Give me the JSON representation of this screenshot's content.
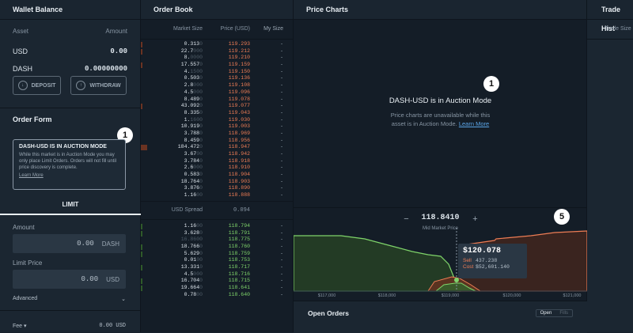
{
  "wallet": {
    "title": "Wallet Balance",
    "col_asset": "Asset",
    "col_amount": "Amount",
    "balances": [
      {
        "asset": "USD",
        "amount": "0.00"
      },
      {
        "asset": "DASH",
        "amount": "0.00000000"
      }
    ],
    "deposit_label": "DEPOSIT",
    "withdraw_label": "WITHDRAW"
  },
  "order_form": {
    "title": "Order Form",
    "notice_title": "DASH-USD IS IN AUCTION MODE",
    "notice_body": "While this market is in Auction Mode you may only place Limit Orders. Orders will not fill until price discovery is complete.",
    "notice_link": "Learn More",
    "tab_limit": "LIMIT",
    "amount_label": "Amount",
    "amount_value": "0.00",
    "amount_unit": "DASH",
    "limit_price_label": "Limit Price",
    "limit_price_value": "0.00",
    "limit_price_unit": "USD",
    "advanced_label": "Advanced",
    "fee_label": "Fee",
    "fee_value": "0.00 USD"
  },
  "badges": {
    "one": "1",
    "five": "5"
  },
  "order_book": {
    "title": "Order Book",
    "col_size": "Market Size",
    "col_price": "Price (USD)",
    "col_mine": "My Size",
    "asks": [
      {
        "size": "0.313",
        "dim": "0",
        "price": "119.293",
        "mine": "-"
      },
      {
        "size": "22.7",
        "dim": "000",
        "price": "119.212",
        "mine": "-"
      },
      {
        "size": "8.",
        "dim": "0000",
        "price": "119.210",
        "mine": "-"
      },
      {
        "size": "17.557",
        "dim": "0",
        "price": "119.159",
        "mine": "-"
      },
      {
        "size": "4.",
        "dim": "1500",
        "price": "119.150",
        "mine": "-"
      },
      {
        "size": "0.503",
        "dim": "0",
        "price": "119.136",
        "mine": "-"
      },
      {
        "size": "2.8",
        "dim": "000",
        "price": "119.108",
        "mine": "-"
      },
      {
        "size": "4.5",
        "dim": "000",
        "price": "119.096",
        "mine": "-"
      },
      {
        "size": "8.489",
        "dim": "0",
        "price": "119.078",
        "mine": "-"
      },
      {
        "size": "43.092",
        "dim": "0",
        "price": "119.077",
        "mine": "-"
      },
      {
        "size": "8.335",
        "dim": "0",
        "price": "119.043",
        "mine": "-"
      },
      {
        "size": "1.",
        "dim": "1600",
        "price": "119.030",
        "mine": "-"
      },
      {
        "size": "10.919",
        "dim": "0",
        "price": "119.003",
        "mine": "-"
      },
      {
        "size": "3.788",
        "dim": "0",
        "price": "118.969",
        "mine": "-"
      },
      {
        "size": "8.459",
        "dim": "0",
        "price": "118.956",
        "mine": "-"
      },
      {
        "size": "184.472",
        "dim": "0",
        "price": "118.947",
        "mine": "-"
      },
      {
        "size": "3.67",
        "dim": "00",
        "price": "118.942",
        "mine": "-"
      },
      {
        "size": "3.784",
        "dim": "0",
        "price": "118.918",
        "mine": "-"
      },
      {
        "size": "2.6",
        "dim": "000",
        "price": "118.910",
        "mine": "-"
      },
      {
        "size": "0.583",
        "dim": "0",
        "price": "118.904",
        "mine": "-"
      },
      {
        "size": "18.764",
        "dim": "0",
        "price": "118.903",
        "mine": "-"
      },
      {
        "size": "3.876",
        "dim": "0",
        "price": "118.890",
        "mine": "-"
      },
      {
        "size": "1.16",
        "dim": "00",
        "price": "118.888",
        "mine": "-"
      }
    ],
    "spread_label": "USD Spread",
    "spread_value": "0.094",
    "bids": [
      {
        "size": "1.16",
        "dim": "00",
        "price": "118.794",
        "mine": "-"
      },
      {
        "size": "3.628",
        "dim": "0",
        "price": "118.791",
        "mine": "-"
      },
      {
        "size": "",
        "dim": "16.8600",
        "price": "118.775",
        "mine": "-"
      },
      {
        "size": "18.766",
        "dim": "0",
        "price": "118.760",
        "mine": "-"
      },
      {
        "size": "5.629",
        "dim": "0",
        "price": "118.759",
        "mine": "-"
      },
      {
        "size": "0.01",
        "dim": "00",
        "price": "118.753",
        "mine": "-"
      },
      {
        "size": "13.331",
        "dim": "0",
        "price": "118.717",
        "mine": "-"
      },
      {
        "size": "4.5",
        "dim": "000",
        "price": "118.716",
        "mine": "-"
      },
      {
        "size": "16.704",
        "dim": "0",
        "price": "118.715",
        "mine": "-"
      },
      {
        "size": "19.664",
        "dim": "0",
        "price": "118.641",
        "mine": "-"
      },
      {
        "size": "0.78",
        "dim": "00",
        "price": "118.640",
        "mine": "-"
      }
    ]
  },
  "charts": {
    "title": "Price Charts",
    "auction_title": "DASH-USD is in Auction Mode",
    "auction_body_1": "Price charts are unavailable while this",
    "auction_body_2": "asset is in Auction Mode.",
    "auction_link": "Learn More",
    "minus": "−",
    "plus": "+",
    "mid_price": "118.8410",
    "mid_label": "Mid Market Price",
    "tooltip_price": "$120.078",
    "tooltip_sell_label": "Sell",
    "tooltip_sell_value": "437.238",
    "tooltip_cost_label": "Cost",
    "tooltip_cost_value": "$52,601.140",
    "xaxis": [
      "$117,000",
      "$118,000",
      "$119,000",
      "$120,000",
      "$121,000"
    ],
    "open_orders_title": "Open Orders",
    "tab_open": "Open",
    "tab_fills": "Fills"
  },
  "trade_history": {
    "title": "Trade Hist",
    "col_size": "Trade Size"
  },
  "colors": {
    "ask": "#ee7d55",
    "bid": "#7fd46a",
    "bg": "#141d27"
  }
}
